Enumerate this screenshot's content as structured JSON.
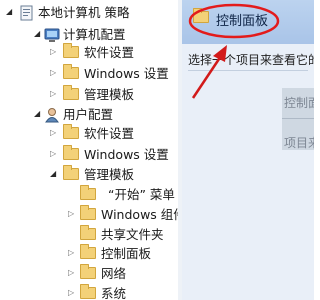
{
  "tree": {
    "root_label": "本地计算机 策略",
    "computer_config_label": "计算机配置",
    "comp_software_label": "软件设置",
    "comp_windows_label": "Windows 设置",
    "comp_admin_label": "管理模板",
    "user_config_label": "用户配置",
    "user_software_label": "软件设置",
    "user_windows_label": "Windows 设置",
    "user_admin_label": "管理模板",
    "start_menu_label": "“开始” 菜单",
    "windows_components_label": "Windows 组件",
    "shared_folders_label": "共享文件夹",
    "control_panel_label": "控制面板",
    "network_label": "网络",
    "system_label": "系统"
  },
  "details": {
    "title": "控制面板",
    "description": "选择一个项目来查看它的描述。",
    "ghost_text_1": "控制面板",
    "ghost_text_2": "项目来"
  },
  "colors": {
    "highlight_ellipse": "#e31b1b",
    "annotation_arrow": "#d21a1a",
    "header_blue": "#b2cbea",
    "folder_yellow": "#f3d178"
  },
  "icons": {
    "root": "policy-icon",
    "computer": "computer-icon",
    "user": "user-icon",
    "folder": "folder-icon",
    "expand": "chevron-right-icon",
    "collapse": "chevron-down-icon"
  }
}
